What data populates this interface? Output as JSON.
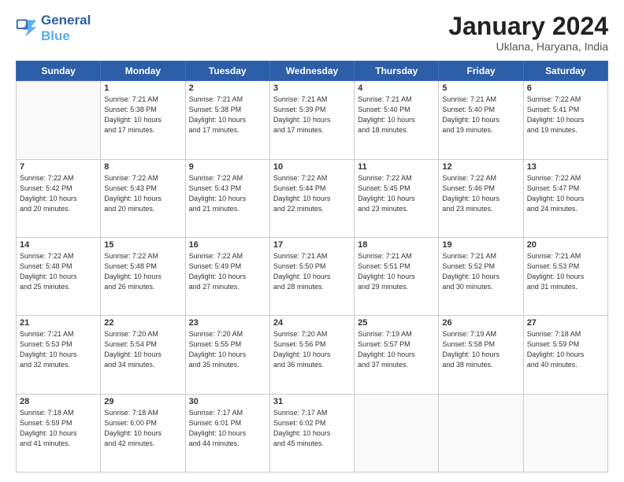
{
  "header": {
    "logo_line1": "General",
    "logo_line2": "Blue",
    "month_year": "January 2024",
    "location": "Uklana, Haryana, India"
  },
  "days_of_week": [
    "Sunday",
    "Monday",
    "Tuesday",
    "Wednesday",
    "Thursday",
    "Friday",
    "Saturday"
  ],
  "weeks": [
    [
      {
        "day": "",
        "info": ""
      },
      {
        "day": "1",
        "info": "Sunrise: 7:21 AM\nSunset: 5:38 PM\nDaylight: 10 hours\nand 17 minutes."
      },
      {
        "day": "2",
        "info": "Sunrise: 7:21 AM\nSunset: 5:38 PM\nDaylight: 10 hours\nand 17 minutes."
      },
      {
        "day": "3",
        "info": "Sunrise: 7:21 AM\nSunset: 5:39 PM\nDaylight: 10 hours\nand 17 minutes."
      },
      {
        "day": "4",
        "info": "Sunrise: 7:21 AM\nSunset: 5:40 PM\nDaylight: 10 hours\nand 18 minutes."
      },
      {
        "day": "5",
        "info": "Sunrise: 7:21 AM\nSunset: 5:40 PM\nDaylight: 10 hours\nand 19 minutes."
      },
      {
        "day": "6",
        "info": "Sunrise: 7:22 AM\nSunset: 5:41 PM\nDaylight: 10 hours\nand 19 minutes."
      }
    ],
    [
      {
        "day": "7",
        "info": "Sunrise: 7:22 AM\nSunset: 5:42 PM\nDaylight: 10 hours\nand 20 minutes."
      },
      {
        "day": "8",
        "info": "Sunrise: 7:22 AM\nSunset: 5:43 PM\nDaylight: 10 hours\nand 20 minutes."
      },
      {
        "day": "9",
        "info": "Sunrise: 7:22 AM\nSunset: 5:43 PM\nDaylight: 10 hours\nand 21 minutes."
      },
      {
        "day": "10",
        "info": "Sunrise: 7:22 AM\nSunset: 5:44 PM\nDaylight: 10 hours\nand 22 minutes."
      },
      {
        "day": "11",
        "info": "Sunrise: 7:22 AM\nSunset: 5:45 PM\nDaylight: 10 hours\nand 23 minutes."
      },
      {
        "day": "12",
        "info": "Sunrise: 7:22 AM\nSunset: 5:46 PM\nDaylight: 10 hours\nand 23 minutes."
      },
      {
        "day": "13",
        "info": "Sunrise: 7:22 AM\nSunset: 5:47 PM\nDaylight: 10 hours\nand 24 minutes."
      }
    ],
    [
      {
        "day": "14",
        "info": "Sunrise: 7:22 AM\nSunset: 5:48 PM\nDaylight: 10 hours\nand 25 minutes."
      },
      {
        "day": "15",
        "info": "Sunrise: 7:22 AM\nSunset: 5:48 PM\nDaylight: 10 hours\nand 26 minutes."
      },
      {
        "day": "16",
        "info": "Sunrise: 7:22 AM\nSunset: 5:49 PM\nDaylight: 10 hours\nand 27 minutes."
      },
      {
        "day": "17",
        "info": "Sunrise: 7:21 AM\nSunset: 5:50 PM\nDaylight: 10 hours\nand 28 minutes."
      },
      {
        "day": "18",
        "info": "Sunrise: 7:21 AM\nSunset: 5:51 PM\nDaylight: 10 hours\nand 29 minutes."
      },
      {
        "day": "19",
        "info": "Sunrise: 7:21 AM\nSunset: 5:52 PM\nDaylight: 10 hours\nand 30 minutes."
      },
      {
        "day": "20",
        "info": "Sunrise: 7:21 AM\nSunset: 5:53 PM\nDaylight: 10 hours\nand 31 minutes."
      }
    ],
    [
      {
        "day": "21",
        "info": "Sunrise: 7:21 AM\nSunset: 5:53 PM\nDaylight: 10 hours\nand 32 minutes."
      },
      {
        "day": "22",
        "info": "Sunrise: 7:20 AM\nSunset: 5:54 PM\nDaylight: 10 hours\nand 34 minutes."
      },
      {
        "day": "23",
        "info": "Sunrise: 7:20 AM\nSunset: 5:55 PM\nDaylight: 10 hours\nand 35 minutes."
      },
      {
        "day": "24",
        "info": "Sunrise: 7:20 AM\nSunset: 5:56 PM\nDaylight: 10 hours\nand 36 minutes."
      },
      {
        "day": "25",
        "info": "Sunrise: 7:19 AM\nSunset: 5:57 PM\nDaylight: 10 hours\nand 37 minutes."
      },
      {
        "day": "26",
        "info": "Sunrise: 7:19 AM\nSunset: 5:58 PM\nDaylight: 10 hours\nand 38 minutes."
      },
      {
        "day": "27",
        "info": "Sunrise: 7:18 AM\nSunset: 5:59 PM\nDaylight: 10 hours\nand 40 minutes."
      }
    ],
    [
      {
        "day": "28",
        "info": "Sunrise: 7:18 AM\nSunset: 5:59 PM\nDaylight: 10 hours\nand 41 minutes."
      },
      {
        "day": "29",
        "info": "Sunrise: 7:18 AM\nSunset: 6:00 PM\nDaylight: 10 hours\nand 42 minutes."
      },
      {
        "day": "30",
        "info": "Sunrise: 7:17 AM\nSunset: 6:01 PM\nDaylight: 10 hours\nand 44 minutes."
      },
      {
        "day": "31",
        "info": "Sunrise: 7:17 AM\nSunset: 6:02 PM\nDaylight: 10 hours\nand 45 minutes."
      },
      {
        "day": "",
        "info": ""
      },
      {
        "day": "",
        "info": ""
      },
      {
        "day": "",
        "info": ""
      }
    ]
  ]
}
